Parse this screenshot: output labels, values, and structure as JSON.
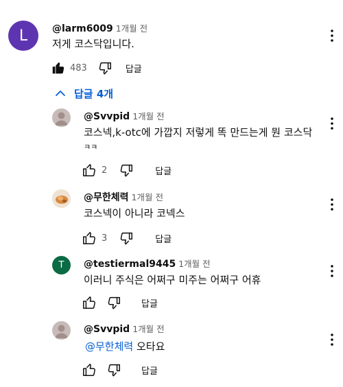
{
  "top_comment": {
    "avatar_letter": "L",
    "avatar_color": "#5e35b1",
    "author": "@larm6009",
    "time": "1개월 전",
    "text": "저게 코스닥입니다.",
    "likes": "483",
    "reply_label": "답글"
  },
  "replies_toggle": {
    "label": "답글 4개",
    "color": "#065fd4"
  },
  "replies": [
    {
      "avatar": "gray-person-icon",
      "author": "@Svvpid",
      "time": "1개월 전",
      "text_line1": "코스넥,k-otc에 가깝지 저렇게 똑 만드는게 뭔 코스닥",
      "text_line2": "ㅋㅋ",
      "likes": "2",
      "reply_label": "답글"
    },
    {
      "avatar": "photo-avatar",
      "author": "@무한체력",
      "time": "1개월 전",
      "text": "코스넥이 아니라 코넥스",
      "likes": "3",
      "reply_label": "답글"
    },
    {
      "avatar_letter": "T",
      "avatar_color": "#0b6b44",
      "author": "@testiermal9445",
      "time": "1개월 전",
      "text": "이러니 주식은 어쩌구 미주는 어쩌구 어휴",
      "reply_label": "답글"
    },
    {
      "avatar": "gray-person-icon",
      "author": "@Svvpid",
      "time": "1개월 전",
      "mention": "@무한체력",
      "text": "오타요",
      "reply_label": "답글"
    }
  ]
}
